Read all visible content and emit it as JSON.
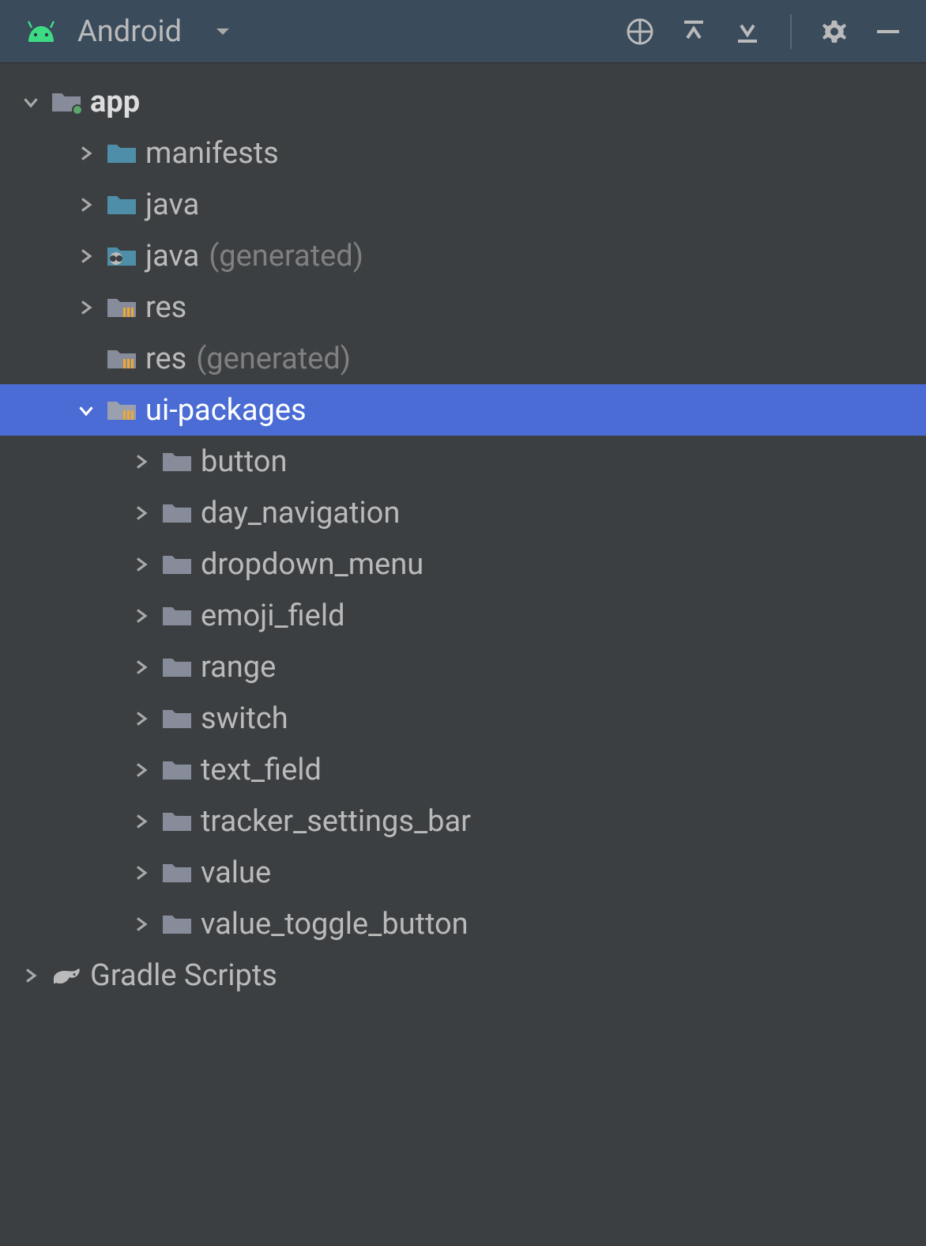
{
  "header": {
    "view_selector": "Android"
  },
  "tree": {
    "root": {
      "label": "app",
      "children": [
        {
          "label": "manifests"
        },
        {
          "label": "java"
        },
        {
          "label": "java",
          "suffix": "(generated)"
        },
        {
          "label": "res"
        },
        {
          "label": "res",
          "suffix": "(generated)"
        },
        {
          "label": "ui-packages",
          "children": [
            {
              "label": "button"
            },
            {
              "label": "day_navigation"
            },
            {
              "label": "dropdown_menu"
            },
            {
              "label": "emoji_field"
            },
            {
              "label": "range"
            },
            {
              "label": "switch"
            },
            {
              "label": "text_field"
            },
            {
              "label": "tracker_settings_bar"
            },
            {
              "label": "value"
            },
            {
              "label": "value_toggle_button"
            }
          ]
        }
      ]
    },
    "gradle": {
      "label": "Gradle Scripts"
    }
  },
  "colors": {
    "header_bg": "#3a4b5c",
    "body_bg": "#3c3f41",
    "selected": "#4a6cd4",
    "text": "#bababa",
    "muted": "#808080",
    "android_green": "#3ddc84",
    "folder_teal": "#4e8ea8",
    "folder_gray": "#878c9a"
  }
}
